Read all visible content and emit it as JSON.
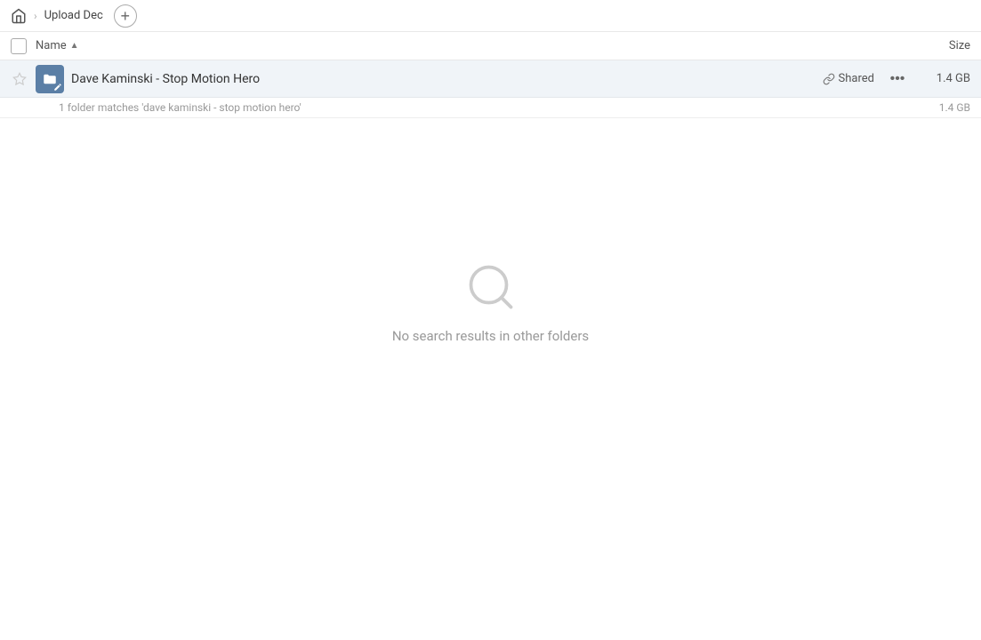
{
  "breadcrumb": {
    "home_label": "home",
    "separator": "›",
    "current": "Upload Dec",
    "add_button_label": "+"
  },
  "columns": {
    "name_label": "Name",
    "sort_arrow": "▲",
    "size_label": "Size"
  },
  "file_row": {
    "name": "Dave Kaminski - Stop Motion Hero",
    "shared_label": "Shared",
    "size": "1.4 GB",
    "more_label": "···"
  },
  "match_row": {
    "text": "1 folder matches 'dave kaminski - stop motion hero'",
    "size": "1.4 GB"
  },
  "empty_state": {
    "message": "No search results in other folders"
  },
  "icons": {
    "home": "⌂",
    "star": "☆",
    "link": "🔗",
    "more": "···",
    "search": "search-icon"
  }
}
